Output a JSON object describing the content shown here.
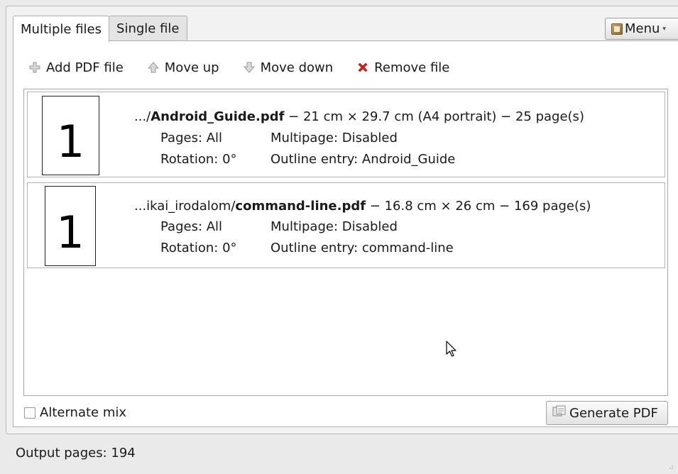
{
  "tabs": [
    {
      "label": "Multiple files",
      "active": true
    },
    {
      "label": "Single file",
      "active": false
    }
  ],
  "menu": {
    "label": "Menu",
    "icon": "menu-icon"
  },
  "toolbar": {
    "add": {
      "label": "Add PDF file",
      "icon": "plus-icon"
    },
    "up": {
      "label": "Move up",
      "icon": "arrow-up-icon"
    },
    "down": {
      "label": "Move down",
      "icon": "arrow-down-icon"
    },
    "remove": {
      "label": "Remove file",
      "icon": "remove-x-icon",
      "color": "#d42020"
    }
  },
  "files": [
    {
      "thumb": "1",
      "path_prefix": ".../",
      "filename": "Android_Guide.pdf",
      "details": " − 21 cm × 29.7 cm (A4 portrait) − 25 page(s)",
      "pages": "Pages: All",
      "multipage": "Multipage: Disabled",
      "rotation": "Rotation: 0°",
      "outline": "Outline entry: Android_Guide"
    },
    {
      "thumb": "1",
      "path_prefix": "...ikai_irodalom/",
      "filename": "command-line.pdf",
      "details": " − 16.8 cm × 26 cm − 169 page(s)",
      "pages": "Pages: All",
      "multipage": "Multipage: Disabled",
      "rotation": "Rotation: 0°",
      "outline": "Outline entry: command-line"
    }
  ],
  "alternate_mix": {
    "label": "Alternate mix",
    "checked": false
  },
  "generate": {
    "label": "Generate PDF",
    "icon": "generate-icon"
  },
  "status": {
    "output_pages": "Output pages: 194"
  }
}
